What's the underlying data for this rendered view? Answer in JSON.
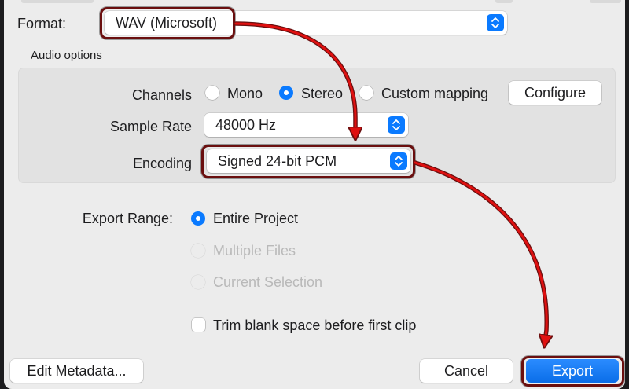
{
  "format": {
    "label": "Format:",
    "value": "WAV (Microsoft)"
  },
  "audio_options": {
    "title": "Audio options",
    "channels": {
      "label": "Channels",
      "options": [
        {
          "label": "Mono",
          "selected": false
        },
        {
          "label": "Stereo",
          "selected": true
        },
        {
          "label": "Custom mapping",
          "selected": false
        }
      ],
      "configure_label": "Configure"
    },
    "sample_rate": {
      "label": "Sample Rate",
      "value": "48000 Hz"
    },
    "encoding": {
      "label": "Encoding",
      "value": "Signed 24-bit PCM"
    }
  },
  "export_range": {
    "label": "Export Range:",
    "options": [
      {
        "label": "Entire Project",
        "selected": true,
        "enabled": true
      },
      {
        "label": "Multiple Files",
        "selected": false,
        "enabled": false
      },
      {
        "label": "Current Selection",
        "selected": false,
        "enabled": false
      }
    ]
  },
  "trim": {
    "label": "Trim blank space before first clip",
    "checked": false
  },
  "footer": {
    "edit_metadata_label": "Edit Metadata...",
    "cancel_label": "Cancel",
    "export_label": "Export"
  },
  "colors": {
    "accent": "#0a7aff",
    "annotation": "#e01010",
    "annotation_outline": "#6a0f0f"
  }
}
